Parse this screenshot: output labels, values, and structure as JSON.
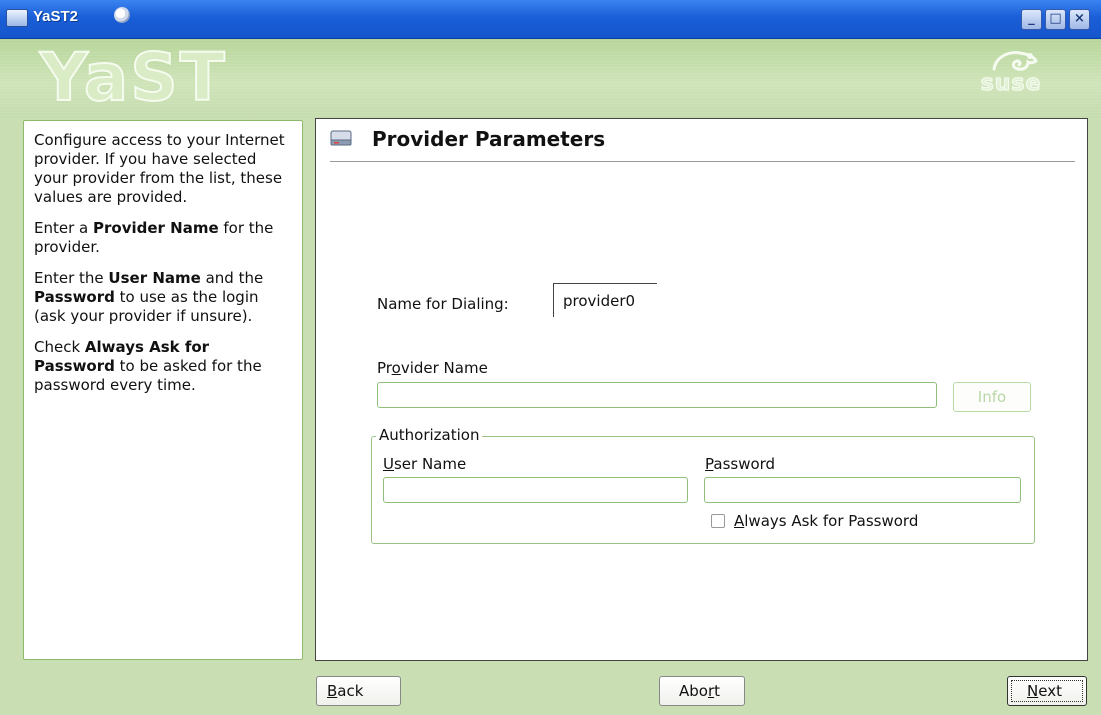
{
  "window": {
    "title": "YaST2",
    "controls": [
      "_",
      "□",
      "×"
    ]
  },
  "header": {
    "logo_text": "YaST",
    "brand_text": "suse"
  },
  "help": {
    "paragraphs": [
      {
        "parts": [
          {
            "t": "Configure access to your Internet provider. If you have selected your provider from the list, these values are provided.",
            "b": false
          }
        ]
      },
      {
        "parts": [
          {
            "t": "Enter a ",
            "b": false
          },
          {
            "t": "Provider Name",
            "b": true
          },
          {
            "t": " for the provider.",
            "b": false
          }
        ]
      },
      {
        "parts": [
          {
            "t": "Enter the ",
            "b": false
          },
          {
            "t": "User Name",
            "b": true
          },
          {
            "t": " and the ",
            "b": false
          },
          {
            "t": "Password",
            "b": true
          },
          {
            "t": " to use as the login (ask your provider if unsure).",
            "b": false
          }
        ]
      },
      {
        "parts": [
          {
            "t": "Check ",
            "b": false
          },
          {
            "t": "Always Ask for Password",
            "b": true
          },
          {
            "t": " to be asked for the password every time.",
            "b": false
          }
        ]
      }
    ]
  },
  "page": {
    "title": "Provider Parameters",
    "dialing_label": "Name for Dialing:",
    "dialing_value": "provider0",
    "provider_name_label": {
      "before": "Pr",
      "underline": "o",
      "after": "vider Name"
    },
    "provider_name_value": "",
    "info_button": "Info",
    "authorization": {
      "title": "Authorization",
      "user_label": {
        "underline": "U",
        "after": "ser Name"
      },
      "user_value": "",
      "password_label": {
        "underline": "P",
        "after": "assword"
      },
      "password_value": "",
      "always_ask": {
        "underline": "A",
        "after": "lways Ask for Password",
        "checked": false
      }
    }
  },
  "buttons": {
    "back": {
      "underline": "B",
      "after": "ack"
    },
    "abort": {
      "before": "Abo",
      "underline": "r",
      "after": "t"
    },
    "next": {
      "underline": "N",
      "after": "ext"
    }
  }
}
